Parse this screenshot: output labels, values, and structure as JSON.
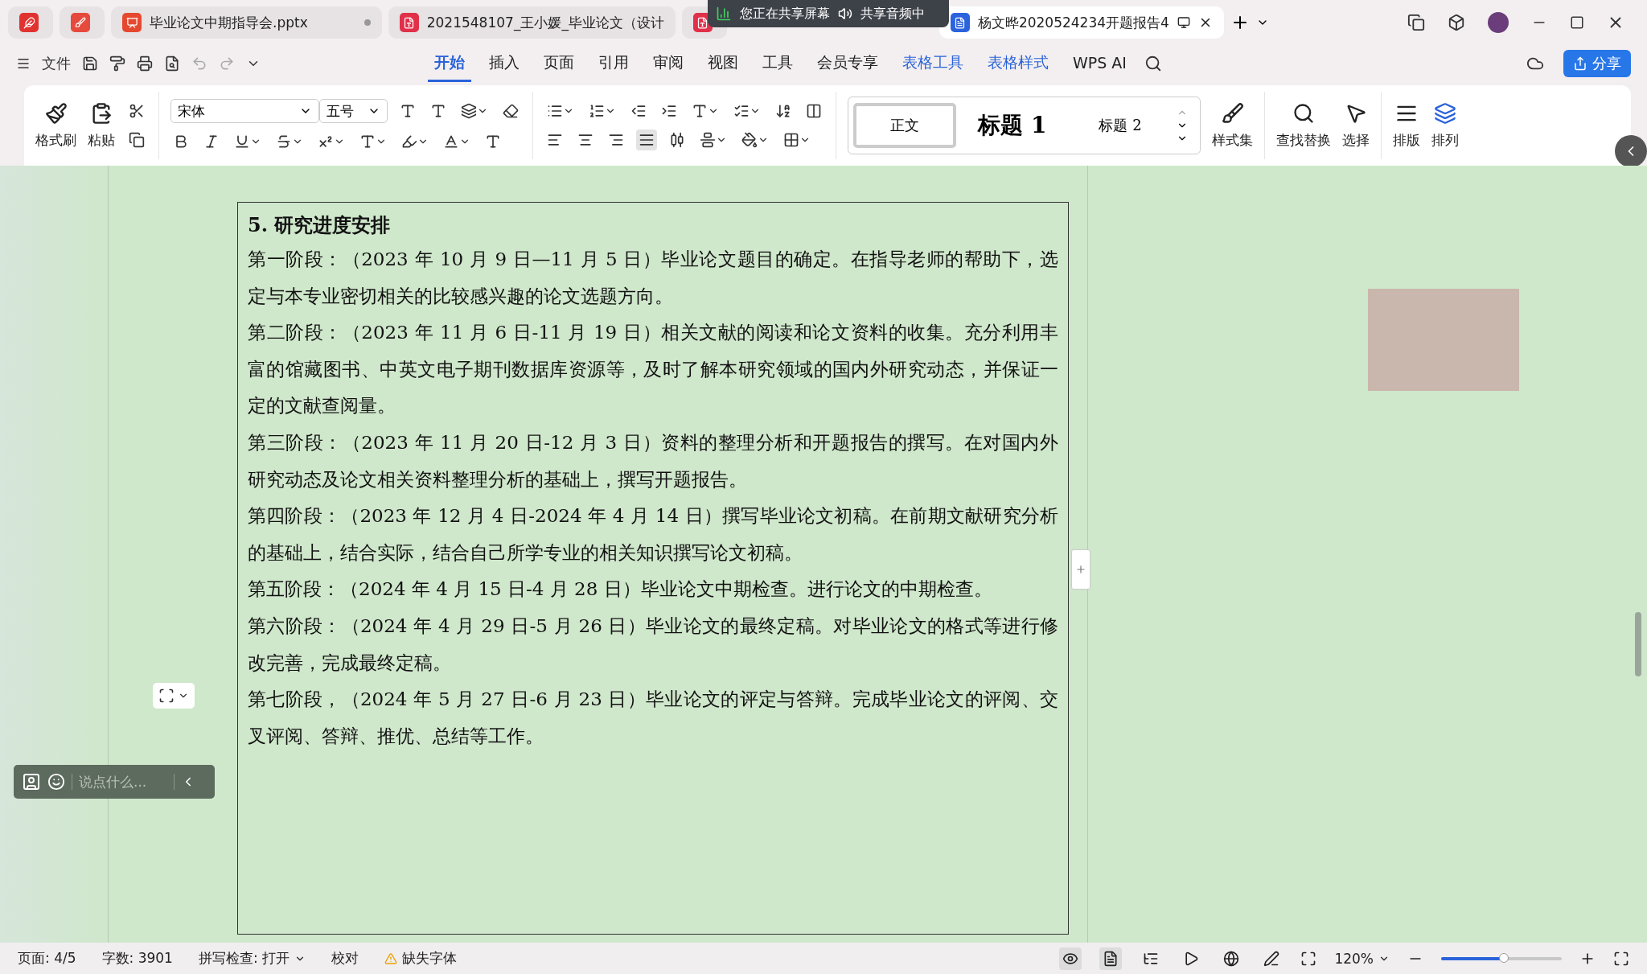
{
  "share_banner": {
    "screen": "您正在共享屏幕",
    "audio": "共享音频中"
  },
  "tabs": [
    {
      "kind": "home",
      "selected": false
    },
    {
      "kind": "pdfapp",
      "selected": false
    },
    {
      "kind": "ppt",
      "label": "毕业论文中期指导会.pptx",
      "selected": false
    },
    {
      "kind": "pdf",
      "label": "2021548107_王小媛_毕业论文（设计",
      "selected": false
    },
    {
      "kind": "pdf",
      "selected": false
    },
    {
      "kind": "doc",
      "label": "杨文晔2020524234开题报告4",
      "selected": true
    }
  ],
  "menu": {
    "file": "文件",
    "tabs": [
      {
        "label": "开始",
        "selected": true,
        "contextual": false
      },
      {
        "label": "插入",
        "selected": false,
        "contextual": false
      },
      {
        "label": "页面",
        "selected": false,
        "contextual": false
      },
      {
        "label": "引用",
        "selected": false,
        "contextual": false
      },
      {
        "label": "审阅",
        "selected": false,
        "contextual": false
      },
      {
        "label": "视图",
        "selected": false,
        "contextual": false
      },
      {
        "label": "工具",
        "selected": false,
        "contextual": false
      },
      {
        "label": "会员专享",
        "selected": false,
        "contextual": false
      },
      {
        "label": "表格工具",
        "selected": false,
        "contextual": true
      },
      {
        "label": "表格样式",
        "selected": false,
        "contextual": true
      }
    ],
    "ai": "WPS AI",
    "share": "分享"
  },
  "ribbon": {
    "format_painter": "格式刷",
    "paste": "粘贴",
    "font": "宋体",
    "size": "五号",
    "align": [
      {
        "kind": "left",
        "selected": false
      },
      {
        "kind": "center",
        "selected": false
      },
      {
        "kind": "right",
        "selected": false
      },
      {
        "kind": "justify",
        "selected": true
      },
      {
        "kind": "distributed",
        "selected": false
      }
    ],
    "styles": [
      {
        "label": "正文",
        "kind": "body",
        "selected": true
      },
      {
        "label": "标题 1",
        "kind": "h1",
        "selected": false
      },
      {
        "label": "标题 2",
        "kind": "h2",
        "selected": false
      }
    ],
    "style_set": "样式集",
    "find": "查找替换",
    "select": "选择",
    "layout": "排版",
    "arrange": "排列"
  },
  "document": {
    "heading": "5. 研究进度安排",
    "paragraphs": [
      "第一阶段：（2023 年 10 月 9 日—11 月 5 日）毕业论文题目的确定。在指导老师的帮助下，选定与本专业密切相关的比较感兴趣的论文选题方向。",
      "第二阶段：（2023 年 11 月 6 日-11 月 19 日）相关文献的阅读和论文资料的收集。充分利用丰富的馆藏图书、中英文电子期刊数据库资源等，及时了解本研究领域的国内外研究动态，并保证一定的文献查阅量。",
      "第三阶段：（2023 年 11 月 20 日-12 月 3 日）资料的整理分析和开题报告的撰写。在对国内外研究动态及论文相关资料整理分析的基础上，撰写开题报告。",
      "第四阶段：（2023 年 12 月 4 日-2024 年 4 月 14 日）撰写毕业论文初稿。在前期文献研究分析的基础上，结合实际，结合自己所学专业的相关知识撰写论文初稿。",
      "第五阶段：（2024 年 4 月 15 日-4 月 28 日）毕业论文中期检查。进行论文的中期检查。",
      "第六阶段：（2024 年 4 月 29 日-5 月 26 日）毕业论文的最终定稿。对毕业论文的格式等进行修改完善，完成最终定稿。",
      "第七阶段，（2024 年 5 月 27 日-6 月 23 日）毕业论文的评定与答辩。完成毕业论文的评阅、交叉评阅、答辩、推优、总结等工作。"
    ]
  },
  "chat": {
    "placeholder": "说点什么..."
  },
  "status_bar": {
    "page": "页面: 4/5",
    "words": "字数: 3901",
    "spell": "拼写检查: 打开",
    "proof": "校对",
    "missing_font": "缺失字体",
    "zoom": "120%",
    "zoom_level": {
      "level": 0.52
    },
    "views": [
      {
        "kind": "read",
        "selected": true
      },
      {
        "kind": "page",
        "selected": true
      },
      {
        "kind": "outline",
        "selected": false
      },
      {
        "kind": "play",
        "selected": false
      },
      {
        "kind": "web",
        "selected": false
      },
      {
        "kind": "pen",
        "selected": false
      }
    ]
  }
}
